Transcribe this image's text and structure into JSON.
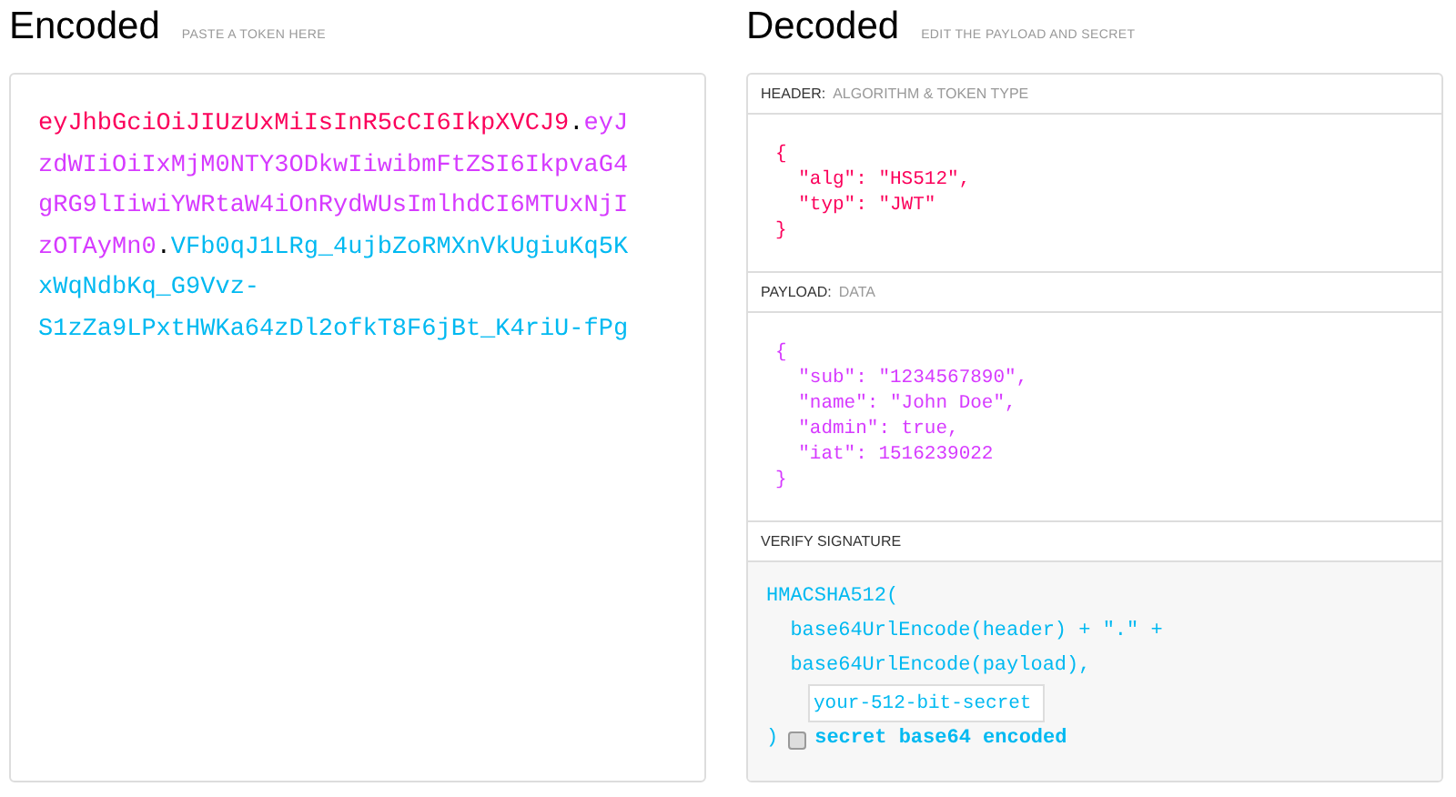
{
  "encoded": {
    "title": "Encoded",
    "subtitle": "PASTE A TOKEN HERE",
    "token_lines": [
      [
        {
          "kind": "header",
          "text": "eyJhbGciOiJIUzUxMiIsInR5cCI6IkpXVCJ9"
        },
        {
          "kind": "dot",
          "text": "."
        },
        {
          "kind": "payload",
          "text": "eyJ"
        }
      ],
      [
        {
          "kind": "payload",
          "text": "zdWIiOiIxMjM0NTY3ODkwIiwibmFtZSI6IkpvaG4"
        }
      ],
      [
        {
          "kind": "payload",
          "text": "gRG9lIiwiYWRtaW4iOnRydWUsImlhdCI6MTUxNjI"
        }
      ],
      [
        {
          "kind": "payload",
          "text": "zOTAyMn0"
        },
        {
          "kind": "dot",
          "text": "."
        },
        {
          "kind": "signature",
          "text": "VFb0qJ1LRg_4ujbZoRMXnVkUgiuKq5K"
        }
      ],
      [
        {
          "kind": "signature",
          "text": "xWqNdbKq_G9Vvz-"
        }
      ],
      [
        {
          "kind": "signature",
          "text": "S1zZa9LPxtHWKa64zDl2ofkT8F6jBt_K4riU-fPg"
        }
      ]
    ]
  },
  "decoded": {
    "title": "Decoded",
    "subtitle": "EDIT THE PAYLOAD AND SECRET",
    "sections": [
      {
        "kind": "header",
        "label": "HEADER:",
        "sublabel": "ALGORITHM & TOKEN TYPE",
        "code": [
          "{",
          "  \"alg\": \"HS512\",",
          "  \"typ\": \"JWT\"",
          "}"
        ]
      },
      {
        "kind": "payload",
        "label": "PAYLOAD:",
        "sublabel": "DATA",
        "code": [
          "{",
          "  \"sub\": \"1234567890\",",
          "  \"name\": \"John Doe\",",
          "  \"admin\": true,",
          "  \"iat\": 1516239022",
          "}"
        ]
      },
      {
        "kind": "signature",
        "label": "VERIFY SIGNATURE",
        "code": [
          "HMACSHA512(",
          "  base64UrlEncode(header) + \".\" +",
          "  base64UrlEncode(payload),"
        ],
        "secret": {
          "placeholder": "your-512-bit-secret"
        },
        "close": ")",
        "checkbox": {
          "label": "secret base64 encoded",
          "checked": false
        }
      }
    ]
  }
}
